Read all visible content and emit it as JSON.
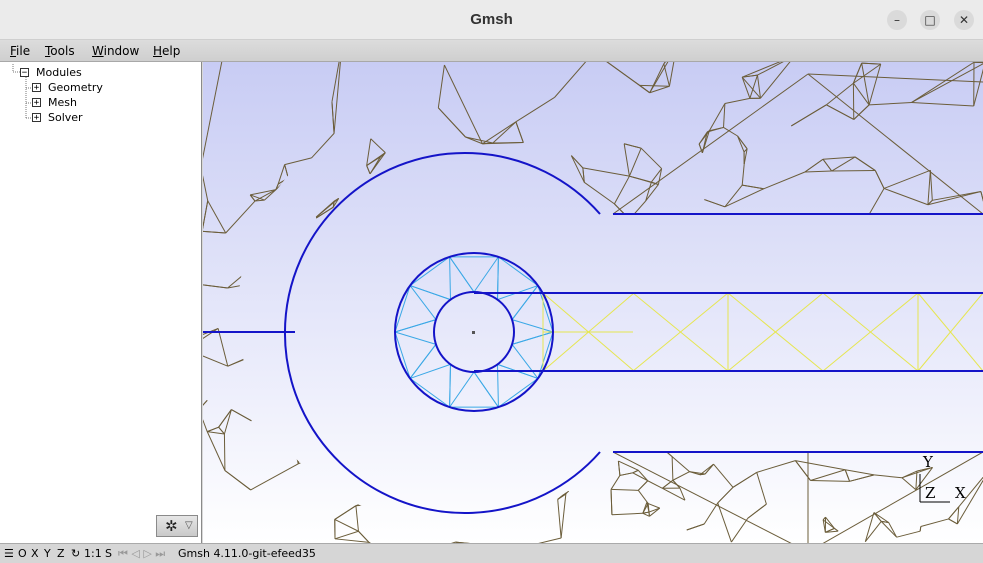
{
  "window": {
    "title": "Gmsh",
    "minimize": "–",
    "maximize": "□",
    "close": "✕"
  },
  "menu": {
    "file": {
      "mnemonic": "F",
      "rest": "ile"
    },
    "tools": {
      "mnemonic": "T",
      "rest": "ools"
    },
    "window": {
      "mnemonic": "W",
      "rest": "indow"
    },
    "help": {
      "mnemonic": "H",
      "rest": "elp"
    }
  },
  "tree": {
    "root": {
      "label": "Modules",
      "toggle": "−"
    },
    "children": [
      {
        "label": "Geometry",
        "toggle": "+"
      },
      {
        "label": "Mesh",
        "toggle": "+"
      },
      {
        "label": "Solver",
        "toggle": "+"
      }
    ]
  },
  "gear_button": {
    "icon": "gear-icon",
    "glyph": "✲",
    "dropdown": "▽"
  },
  "axes": {
    "y": "Y",
    "z": "Z",
    "x": "X"
  },
  "status": {
    "menu_icon": "☰",
    "o": "O",
    "x": "X",
    "y": "Y",
    "z": "Z",
    "rotate_icon": "↻",
    "scale": "1:1",
    "s": "S",
    "playback": "⏮ ◁ ▷ ⏭",
    "message": "Gmsh 4.11.0-git-efeed35"
  },
  "colors": {
    "boundary": "#1414c8",
    "inner_mesh": "#3aa8e6",
    "strip_mesh": "#e6e650",
    "outer_mesh": "#6b5d3a",
    "background_top": "#c8ccf4",
    "background_bottom": "#ffffff"
  }
}
